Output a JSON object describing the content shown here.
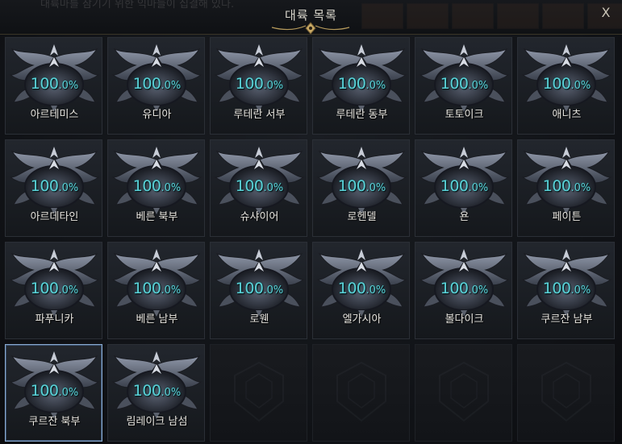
{
  "background": {
    "quest_text": "대륙마를 잠기기 위한 익마들이 집결해 있다."
  },
  "window": {
    "title": "대륙 목록",
    "close_label": "X"
  },
  "colors": {
    "percent_text": "#59d2d8",
    "selected_border": "#8aaad0"
  },
  "continents": [
    {
      "name": "아르테미스",
      "pct_int": "100",
      "pct_dec": ".0%",
      "progress": 1.0,
      "selected": false
    },
    {
      "name": "유디아",
      "pct_int": "100",
      "pct_dec": ".0%",
      "progress": 1.0,
      "selected": false
    },
    {
      "name": "루테란 서부",
      "pct_int": "100",
      "pct_dec": ".0%",
      "progress": 1.0,
      "selected": false
    },
    {
      "name": "루테란 동부",
      "pct_int": "100",
      "pct_dec": ".0%",
      "progress": 1.0,
      "selected": false
    },
    {
      "name": "토토이크",
      "pct_int": "100",
      "pct_dec": ".0%",
      "progress": 1.0,
      "selected": false
    },
    {
      "name": "애니츠",
      "pct_int": "100",
      "pct_dec": ".0%",
      "progress": 1.0,
      "selected": false
    },
    {
      "name": "아르데타인",
      "pct_int": "100",
      "pct_dec": ".0%",
      "progress": 1.0,
      "selected": false
    },
    {
      "name": "베른 북부",
      "pct_int": "100",
      "pct_dec": ".0%",
      "progress": 1.0,
      "selected": false
    },
    {
      "name": "슈샤이어",
      "pct_int": "100",
      "pct_dec": ".0%",
      "progress": 1.0,
      "selected": false
    },
    {
      "name": "로헨델",
      "pct_int": "100",
      "pct_dec": ".0%",
      "progress": 1.0,
      "selected": false
    },
    {
      "name": "욘",
      "pct_int": "100",
      "pct_dec": ".0%",
      "progress": 1.0,
      "selected": false
    },
    {
      "name": "페이튼",
      "pct_int": "100",
      "pct_dec": ".0%",
      "progress": 1.0,
      "selected": false
    },
    {
      "name": "파푸니카",
      "pct_int": "100",
      "pct_dec": ".0%",
      "progress": 1.0,
      "selected": false
    },
    {
      "name": "베른 남부",
      "pct_int": "100",
      "pct_dec": ".0%",
      "progress": 1.0,
      "selected": false
    },
    {
      "name": "로웬",
      "pct_int": "100",
      "pct_dec": ".0%",
      "progress": 1.0,
      "selected": false
    },
    {
      "name": "엘가시아",
      "pct_int": "100",
      "pct_dec": ".0%",
      "progress": 1.0,
      "selected": false
    },
    {
      "name": "볼다이크",
      "pct_int": "100",
      "pct_dec": ".0%",
      "progress": 1.0,
      "selected": false
    },
    {
      "name": "쿠르잔 남부",
      "pct_int": "100",
      "pct_dec": ".0%",
      "progress": 1.0,
      "selected": false
    },
    {
      "name": "쿠르잔 북부",
      "pct_int": "100",
      "pct_dec": ".0%",
      "progress": 1.0,
      "selected": true
    },
    {
      "name": "림레이크 남섬",
      "pct_int": "100",
      "pct_dec": ".0%",
      "progress": 1.0,
      "selected": false
    }
  ],
  "empty_slot_count": 4
}
